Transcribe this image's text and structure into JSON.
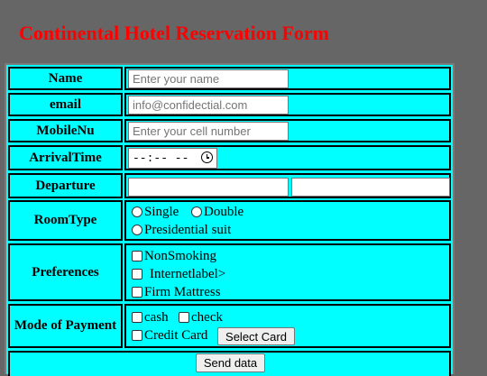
{
  "page": {
    "title": "Continental Hotel Reservation Form"
  },
  "form": {
    "name": {
      "label": "Name",
      "placeholder": "Enter your name"
    },
    "email": {
      "label": "email",
      "placeholder": "info@confidectial.com"
    },
    "mobile": {
      "label": "MobileNu",
      "placeholder": "Enter your cell number"
    },
    "arrival": {
      "label": "ArrivalTime",
      "value": "--:-- --"
    },
    "departure": {
      "label": "Departure"
    },
    "room_type": {
      "label": "RoomType",
      "options": [
        "Single",
        "Double",
        "Presidential suit"
      ]
    },
    "preferences": {
      "label": "Preferences",
      "options": [
        "NonSmoking",
        "Internetlabel>",
        "Firm Mattress"
      ]
    },
    "payment": {
      "label": "Mode of Payment",
      "options": [
        "cash",
        "check",
        "Credit Card"
      ],
      "select_card_label": "Select Card"
    },
    "submit_label": "Send data"
  },
  "colors": {
    "background": "#666666",
    "form_bg": "#00ffff",
    "title": "#ff0000",
    "border": "#000000"
  },
  "icons": {
    "time_picker": "clock-icon"
  }
}
